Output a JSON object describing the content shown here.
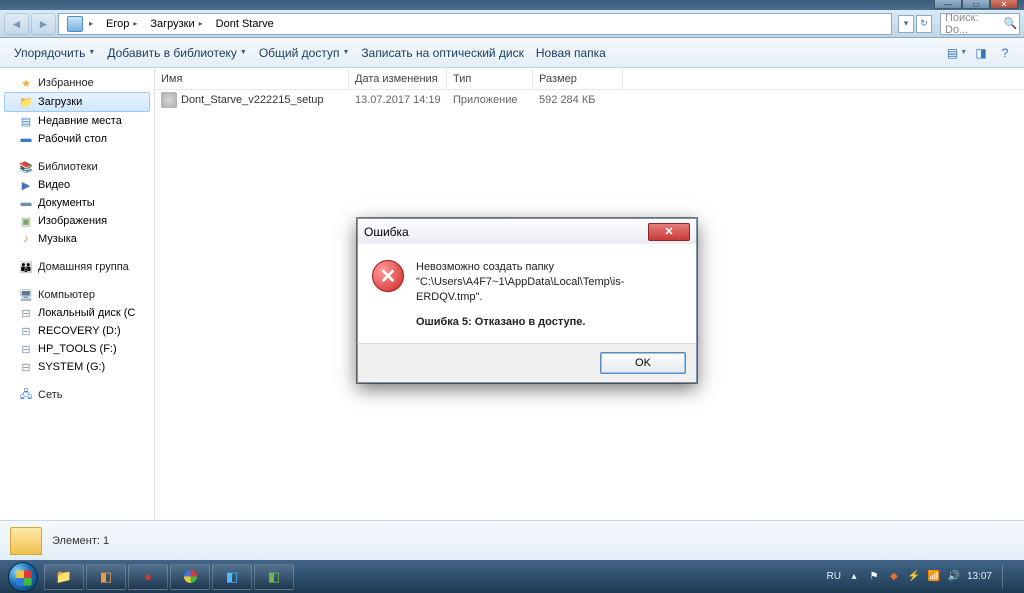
{
  "breadcrumb": {
    "p1": "Егор",
    "p2": "Загрузки",
    "p3": "Dont Starve"
  },
  "search": {
    "placeholder": "Поиск: Do..."
  },
  "toolbar": {
    "organize": "Упорядочить",
    "add_lib": "Добавить в библиотеку",
    "share": "Общий доступ",
    "burn": "Записать на оптический диск",
    "new_folder": "Новая папка"
  },
  "sidebar": {
    "favorites": "Избранное",
    "downloads": "Загрузки",
    "recent": "Недавние места",
    "desktop": "Рабочий стол",
    "libraries": "Библиотеки",
    "video": "Видео",
    "documents": "Документы",
    "pictures": "Изображения",
    "music": "Музыка",
    "homegroup": "Домашняя группа",
    "computer": "Компьютер",
    "local": "Локальный диск (C",
    "recovery": "RECOVERY (D:)",
    "hptools": "HP_TOOLS (F:)",
    "system": "SYSTEM (G:)",
    "network": "Сеть"
  },
  "columns": {
    "name": "Имя",
    "date": "Дата изменения",
    "type": "Тип",
    "size": "Размер"
  },
  "file": {
    "name": "Dont_Starve_v222215_setup",
    "date": "13.07.2017 14:19",
    "type": "Приложение",
    "size": "592 284 КБ"
  },
  "status": {
    "text": "Элемент: 1"
  },
  "dialog": {
    "title": "Ошибка",
    "line1": "Невозможно создать папку",
    "line2": "\"C:\\Users\\A4F7~1\\AppData\\Local\\Temp\\is-ERDQV.tmp\".",
    "line3": "Ошибка 5: Отказано в доступе.",
    "ok": "OK"
  },
  "tray": {
    "lang": "RU",
    "time": "13:07"
  }
}
